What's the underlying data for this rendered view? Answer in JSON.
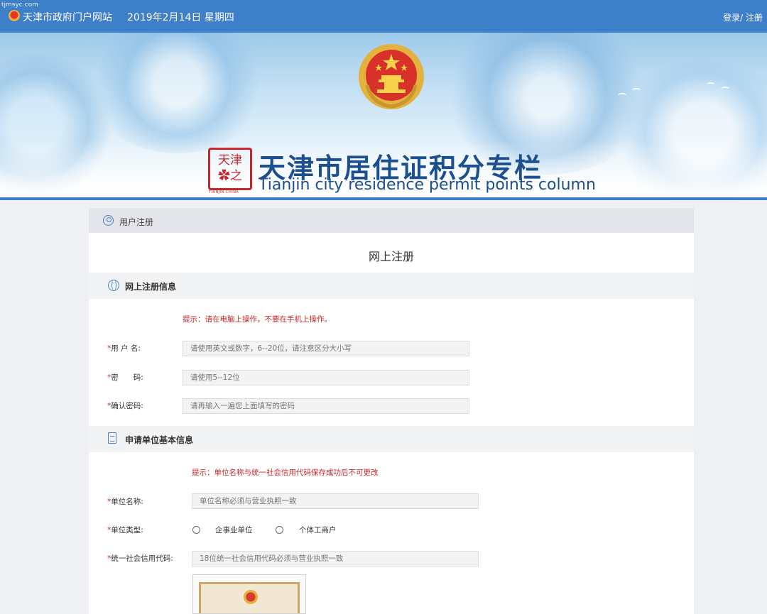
{
  "watermark": "tjmsyc.com",
  "topbar": {
    "site_name": "天津市政府门户网站",
    "date": "2019年2月14日 星期四",
    "login": "登录/ 注册"
  },
  "banner": {
    "title_cn": "天津市居住证积分专栏",
    "title_en": "Tianjin city residence permit points column",
    "seal_text": "天津 之 ❀",
    "seal_caption": "TIANJIN CHINA"
  },
  "panel": {
    "header": "用户注册",
    "title": "网上注册"
  },
  "section_account": {
    "title": "网上注册信息",
    "hint": "提示：请在电脑上操作，不要在手机上操作。",
    "fields": [
      {
        "label": "用 户 名:",
        "placeholder": "请使用英文或数字，6--20位，请注意区分大小写"
      },
      {
        "label": "密　　码:",
        "placeholder": "请使用5--12位"
      },
      {
        "label": "确认密码:",
        "placeholder": "请再输入一遍您上面填写的密码"
      }
    ]
  },
  "section_unit": {
    "title": "申请单位基本信息",
    "hint": "提示：单位名称与统一社会信用代码保存成功后不可更改",
    "name_label": "单位名称:",
    "name_placeholder": "单位名称必须与营业执照一致",
    "type_label": "单位类型:",
    "type_options": [
      "企事业单位",
      "个体工商户"
    ],
    "code_label": "统一社会信用代码:",
    "code_placeholder": "18位统一社会信用代码必须与营业执照一致"
  },
  "colors": {
    "topbar": "#3d7fc8",
    "title": "#1c4f8e",
    "required": "#c8262a"
  }
}
